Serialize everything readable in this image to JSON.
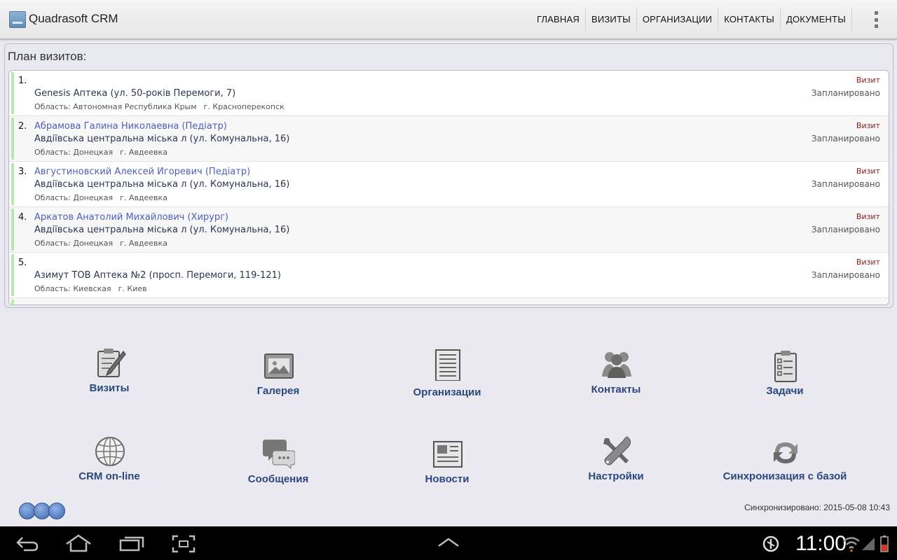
{
  "app": {
    "title": "Quadrasoft CRM"
  },
  "nav": {
    "items": [
      {
        "label": "ГЛАВНАЯ"
      },
      {
        "label": "ВИЗИТЫ"
      },
      {
        "label": "ОРГАНИЗАЦИИ"
      },
      {
        "label": "КОНТАКТЫ"
      },
      {
        "label": "ДОКУМЕНТЫ"
      }
    ]
  },
  "plan": {
    "title": "План визитов:",
    "visits": [
      {
        "num": "1.",
        "person": "",
        "org": "Genesis Аптека (ул. 50-років Перемоги, 7)",
        "region": "Область: Автономная Республика Крым",
        "city": "г. Красноперекопск",
        "type": "Визит",
        "status": "Запланировано"
      },
      {
        "num": "2.",
        "person": "Абрамова Галина Николаевна (Педіатр)",
        "org": "Авдіївська центральна міська л (ул. Комунальна, 16)",
        "region": "Область: Донецкая",
        "city": "г. Авдеевка",
        "type": "Визит",
        "status": "Запланировано"
      },
      {
        "num": "3.",
        "person": "Августиновский Алексей Игоревич (Педіатр)",
        "org": "Авдіївська центральна міська л (ул. Комунальна, 16)",
        "region": "Область: Донецкая",
        "city": "г. Авдеевка",
        "type": "Визит",
        "status": "Запланировано"
      },
      {
        "num": "4.",
        "person": "Аркатов Анатолий Михайлович (Хирург)",
        "org": "Авдіївська центральна міська л (ул. Комунальна, 16)",
        "region": "Область: Донецкая",
        "city": "г. Авдеевка",
        "type": "Визит",
        "status": "Запланировано"
      },
      {
        "num": "5.",
        "person": "",
        "org": "Азимут ТОВ Аптека №2 (просп. Перемоги, 119-121)",
        "region": "Область: Киевская",
        "city": "г. Киев",
        "type": "Визит",
        "status": "Запланировано"
      }
    ]
  },
  "tiles": {
    "visits": {
      "label": "Визиты",
      "icon": "clipboard-pencil-icon"
    },
    "gallery": {
      "label": "Галерея",
      "icon": "photo-box-icon"
    },
    "organizations": {
      "label": "Организации",
      "icon": "document-list-icon"
    },
    "contacts": {
      "label": "Контакты",
      "icon": "people-icon"
    },
    "tasks": {
      "label": "Задачи",
      "icon": "checklist-icon"
    },
    "crm_online": {
      "label": "CRM on-line",
      "icon": "globe-icon"
    },
    "messages": {
      "label": "Сообщения",
      "icon": "chat-bubbles-icon"
    },
    "news": {
      "label": "Новости",
      "icon": "newspaper-icon"
    },
    "settings": {
      "label": "Настройки",
      "icon": "tools-icon"
    },
    "sync": {
      "label": "Синхронизация с базой",
      "icon": "sync-arrows-icon"
    }
  },
  "footer": {
    "sync_status": "Синхронизировано: 2015-05-08 10:43"
  },
  "system": {
    "time": "11:00"
  }
}
